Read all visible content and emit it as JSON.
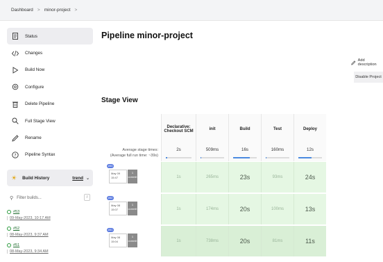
{
  "breadcrumb": {
    "items": [
      "Dashboard",
      "minor-project"
    ],
    "separator": ">"
  },
  "sidebar": {
    "items": [
      {
        "label": "Status",
        "icon": "document-icon",
        "active": true
      },
      {
        "label": "Changes",
        "icon": "code-icon"
      },
      {
        "label": "Build Now",
        "icon": "play-icon"
      },
      {
        "label": "Configure",
        "icon": "gear-icon"
      },
      {
        "label": "Delete Pipeline",
        "icon": "trash-icon"
      },
      {
        "label": "Full Stage View",
        "icon": "search-icon"
      },
      {
        "label": "Rename",
        "icon": "pencil-icon"
      },
      {
        "label": "Pipeline Syntax",
        "icon": "help-icon"
      }
    ]
  },
  "build_history": {
    "title": "Build History",
    "trend_label": "trend",
    "filter_placeholder": "Filter builds...",
    "filter_shortcut": "/",
    "entries": [
      {
        "number": "#53",
        "date": "09-May-2023, 10:17 AM"
      },
      {
        "number": "#52",
        "date": "08-May-2023, 9:37 AM"
      },
      {
        "number": "#51",
        "date": "08-May-2023, 9:34 AM"
      }
    ]
  },
  "main": {
    "title": "Pipeline minor-project",
    "add_description": "Add description",
    "disable_button": "Disable Project",
    "stage_view_title": "Stage View"
  },
  "stage_view": {
    "avg_label_line1": "Average stage times:",
    "avg_label_line2": "(Average full run time: ~39s)",
    "stages": [
      {
        "name": "Declarative: Checkout SCM",
        "avg": "2s",
        "fill": 0.05
      },
      {
        "name": "init",
        "avg": "509ms",
        "fill": 0.02
      },
      {
        "name": "Build",
        "avg": "16s",
        "fill": 0.7
      },
      {
        "name": "Test",
        "avg": "160ms",
        "fill": 0.01
      },
      {
        "name": "Deploy",
        "avg": "12s",
        "fill": 0.55
      }
    ],
    "runs": [
      {
        "badge": "#53",
        "date": "May 09",
        "time": "15:47",
        "commits": "1",
        "commit_label": "commit",
        "times": [
          "1s",
          "265ms",
          "23s",
          "93ms",
          "24s"
        ]
      },
      {
        "badge": "#52",
        "date": "May 08",
        "time": "15:07",
        "commits": "1",
        "commit_label": "commit",
        "times": [
          "1s",
          "174ms",
          "20s",
          "100ms",
          "13s"
        ]
      },
      {
        "badge": "#51",
        "date": "May 08",
        "time": "15:04",
        "commits": "1",
        "commit_label": "commit",
        "times": [
          "1s",
          "738ms",
          "20s",
          "81ms",
          "11s"
        ]
      }
    ]
  },
  "colors": {
    "success_green": "#e5f7e3",
    "accent_blue": "#4a8ae0",
    "badge_blue": "#5b7be0"
  }
}
